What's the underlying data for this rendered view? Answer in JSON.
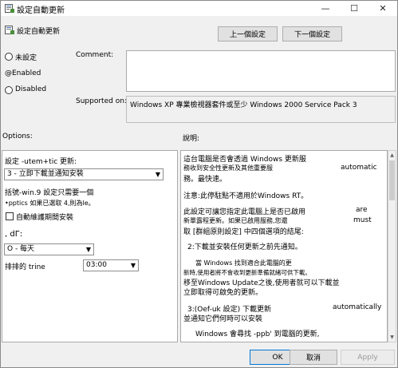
{
  "window": {
    "title": "設定自動更新",
    "minimize_glyph": "—",
    "maximize_glyph": "☐",
    "close_glyph": "✕"
  },
  "header": {
    "title": "設定自動更新",
    "prev_button": "上一個設定",
    "next_button": "下一個設定"
  },
  "state": {
    "not_configured": "未設定",
    "enabled": "@Enabled",
    "disabled": "Disabled",
    "selected": "enabled"
  },
  "comment_label": "Comment:",
  "comment_value": "",
  "supported_label": "Supported on:",
  "supported_value": "Windows XP 專業檢視器套件或至少 Windows 2000 Service Pack 3",
  "options_label": "Options:",
  "help_label": "說明:",
  "options": {
    "configure_label": "設定 -utem+tic 更新:",
    "configure_value": "3 - 立即下載並通知安裝",
    "note_line1": "括號-win.9 設定只需要一個",
    "note_line2": "•pptics 如果已選取 4,則為le。",
    "install_checkbox_label": "自動維護期間安裝",
    "symbol_text": ", dГ:",
    "day_value": "O - 每天",
    "time_label": "排排的 trine",
    "time_value": "03:00"
  },
  "help_lines": [
    "這台電腦是否會透過 Windows 更新服",
    "務收到安全性更新及其他重要服",
    "automatic",
    "務。最快速。",
    "注意:此停駐點不適用於Windows RT。",
    "此設定可讓您指定此電腦上是否已啟用",
    "are",
    "新單露程更新。如果已啟用服務,您還",
    "must",
    "取 [群組原則設定] 中四個選項的結尾:",
    "2:下載並安裝任何更新之前先通知。",
    "當 Windows 找到適合此電腦的更",
    "新時,使用者將不會收到更新準備就緒可供下載。",
    "移至Windows Update之後,使用者就可以下載並",
    "立即取得可啟免的更新。",
    "3:(Oef-uk 設定) 下載更新",
    "automatically",
    "並通知它們何時可以安裝",
    "Windows 會尋找 -ppb' 到電腦的更新,"
  ],
  "footer": {
    "ok": "OK",
    "cancel": "取消",
    "apply": "Apply"
  }
}
